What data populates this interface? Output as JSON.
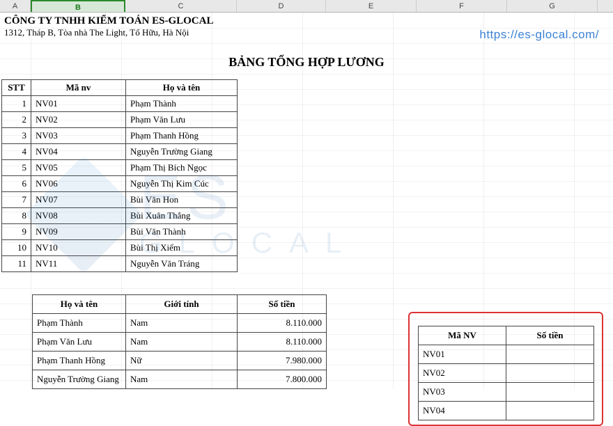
{
  "columns": [
    "A",
    "B",
    "C",
    "D",
    "E",
    "F",
    "G"
  ],
  "selected_column": "B",
  "company_name": "CÔNG TY TNHH KIỂM TOÁN ES-GLOCAL",
  "company_address": "1312, Tháp B, Tòa nhà The Light, Tố Hữu, Hà Nội",
  "url": "https://es-glocal.com/",
  "title": "BẢNG TỔNG HỢP LƯƠNG",
  "main_table": {
    "headers": {
      "stt": "STT",
      "ma": "Mã nv",
      "ten": "Họ và tên"
    },
    "rows": [
      {
        "stt": "1",
        "ma": "NV01",
        "ten": "Phạm Thành"
      },
      {
        "stt": "2",
        "ma": "NV02",
        "ten": "Phạm Văn Lưu"
      },
      {
        "stt": "3",
        "ma": "NV03",
        "ten": "Phạm Thanh Hồng"
      },
      {
        "stt": "4",
        "ma": "NV04",
        "ten": "Nguyễn Trường Giang"
      },
      {
        "stt": "5",
        "ma": "NV05",
        "ten": "Phạm Thị Bích Ngọc"
      },
      {
        "stt": "6",
        "ma": "NV06",
        "ten": "Nguyễn Thị Kim Cúc"
      },
      {
        "stt": "7",
        "ma": "NV07",
        "ten": "Bùi Văn Hon"
      },
      {
        "stt": "8",
        "ma": "NV08",
        "ten": "Bùi Xuân Thắng"
      },
      {
        "stt": "9",
        "ma": "NV09",
        "ten": "Bùi Văn Thành"
      },
      {
        "stt": "10",
        "ma": "NV10",
        "ten": "Bùi Thị Xiểm"
      },
      {
        "stt": "11",
        "ma": "NV11",
        "ten": "Nguyễn Văn Tráng"
      }
    ]
  },
  "lower_left": {
    "headers": {
      "ten": "Họ và tên",
      "gt": "Giới tính",
      "st": "Số tiền"
    },
    "rows": [
      {
        "ten": "Phạm Thành",
        "gt": "Nam",
        "st": "8.110.000"
      },
      {
        "ten": "Phạm Văn Lưu",
        "gt": "Nam",
        "st": "8.110.000"
      },
      {
        "ten": "Phạm Thanh Hồng",
        "gt": "Nữ",
        "st": "7.980.000"
      },
      {
        "ten": "Nguyễn Trường Giang",
        "gt": "Nam",
        "st": "7.800.000"
      }
    ]
  },
  "lower_right": {
    "headers": {
      "ma": "Mã NV",
      "st": "Số tiền"
    },
    "rows": [
      {
        "ma": "NV01",
        "st": ""
      },
      {
        "ma": "NV02",
        "st": ""
      },
      {
        "ma": "NV03",
        "st": ""
      },
      {
        "ma": "NV04",
        "st": ""
      }
    ]
  },
  "watermark": {
    "brand": "ES",
    "sub": "GLOCAL"
  }
}
